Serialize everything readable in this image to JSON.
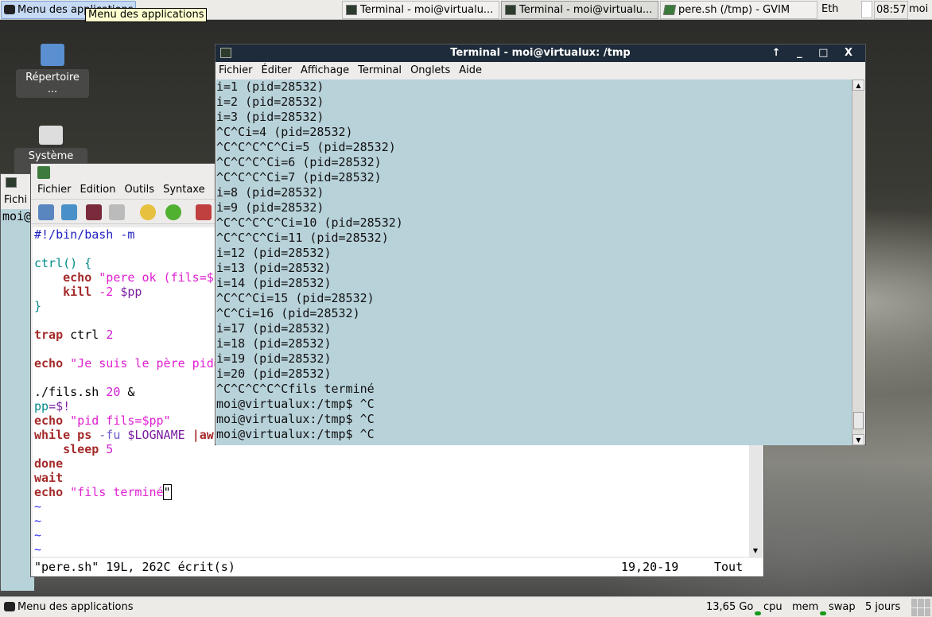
{
  "top_panel": {
    "menu_label": "Menu des applications",
    "tooltip": "Menu des applications",
    "tasks": [
      {
        "label": "Terminal - moi@virtualu..."
      },
      {
        "label": "Terminal - moi@virtualu..."
      },
      {
        "label": "pere.sh (/tmp) - GVIM"
      }
    ],
    "network": "Eth",
    "clock": "08:57",
    "user": "moi"
  },
  "desktop": {
    "icons": [
      {
        "label": "Répertoire ..."
      },
      {
        "label": "Système de..."
      }
    ]
  },
  "terminal": {
    "title": "Terminal - moi@virtualux: /tmp",
    "window_buttons": "↑ _ □ X",
    "menu": [
      "Fichier",
      "Éditer",
      "Affichage",
      "Terminal",
      "Onglets",
      "Aide"
    ],
    "lines": [
      "i=1 (pid=28532)",
      "i=2 (pid=28532)",
      "i=3 (pid=28532)",
      "^C^Ci=4 (pid=28532)",
      "^C^C^C^C^Ci=5 (pid=28532)",
      "^C^C^C^Ci=6 (pid=28532)",
      "^C^C^C^Ci=7 (pid=28532)",
      "i=8 (pid=28532)",
      "i=9 (pid=28532)",
      "^C^C^C^C^Ci=10 (pid=28532)",
      "^C^C^C^Ci=11 (pid=28532)",
      "i=12 (pid=28532)",
      "i=13 (pid=28532)",
      "i=14 (pid=28532)",
      "^C^C^Ci=15 (pid=28532)",
      "^C^Ci=16 (pid=28532)",
      "i=17 (pid=28532)",
      "i=18 (pid=28532)",
      "i=19 (pid=28532)",
      "i=20 (pid=28532)",
      "^C^C^C^C^Cfils terminé",
      "moi@virtualux:/tmp$ ^C",
      "moi@virtualux:/tmp$ ^C",
      "moi@virtualux:/tmp$ ^C"
    ]
  },
  "bg_terminal": {
    "menu_first": "Fichi",
    "prompt": "moi@"
  },
  "gvim": {
    "menu": [
      "Fichier",
      "Edition",
      "Outils",
      "Syntaxe"
    ],
    "code": [
      [
        {
          "t": "#!/bin/bash -m",
          "c": "c"
        }
      ],
      [],
      [
        {
          "t": "ctrl() {",
          "c": "f"
        }
      ],
      [
        {
          "t": "    "
        },
        {
          "t": "echo",
          "c": "k"
        },
        {
          "t": " \"pere ok (fils=$p",
          "c": "s"
        }
      ],
      [
        {
          "t": "    "
        },
        {
          "t": "kill",
          "c": "k"
        },
        {
          "t": " -2 ",
          "c": "s"
        },
        {
          "t": "$pp",
          "c": "v"
        }
      ],
      [
        {
          "t": "}",
          "c": "f"
        }
      ],
      [],
      [
        {
          "t": "trap",
          "c": "k"
        },
        {
          "t": " ctrl "
        },
        {
          "t": "2",
          "c": "n"
        }
      ],
      [],
      [
        {
          "t": "echo",
          "c": "k"
        },
        {
          "t": " \"Je suis le père pid=",
          "c": "s"
        }
      ],
      [],
      [
        {
          "t": "./fils.sh "
        },
        {
          "t": "20",
          "c": "n"
        },
        {
          "t": " &"
        }
      ],
      [
        {
          "t": "pp",
          "c": "f"
        },
        {
          "t": "=$!",
          "c": "v"
        }
      ],
      [
        {
          "t": "echo",
          "c": "k"
        },
        {
          "t": " \"pid fils=$pp\"",
          "c": "s"
        }
      ],
      [
        {
          "t": "while ps",
          "c": "k"
        },
        {
          "t": " -fu",
          "c": "o"
        },
        {
          "t": " $LOGNAME ",
          "c": "v"
        },
        {
          "t": "|awk",
          "c": "k"
        }
      ],
      [
        {
          "t": "    "
        },
        {
          "t": "sleep",
          "c": "k"
        },
        {
          "t": " 5",
          "c": "n"
        }
      ],
      [
        {
          "t": "done",
          "c": "k"
        }
      ],
      [
        {
          "t": "wait",
          "c": "k"
        }
      ],
      [
        {
          "t": "echo",
          "c": "k"
        },
        {
          "t": " \"fils terminé",
          "c": "s"
        },
        {
          "t": "\"",
          "c": "cursor"
        }
      ],
      [
        {
          "t": "~",
          "c": "t"
        }
      ],
      [
        {
          "t": "~",
          "c": "t"
        }
      ],
      [
        {
          "t": "~",
          "c": "t"
        }
      ],
      [
        {
          "t": "~",
          "c": "t"
        }
      ]
    ],
    "status_left": "\"pere.sh\" 19L, 262C écrit(s)",
    "status_pos": "19,20-19",
    "status_scroll": "Tout"
  },
  "bottom_panel": {
    "menu_label": "Menu des applications",
    "disk": "13,65 Go",
    "cpu": "cpu",
    "mem": "mem",
    "swap": "swap",
    "uptime": "5 jours"
  }
}
